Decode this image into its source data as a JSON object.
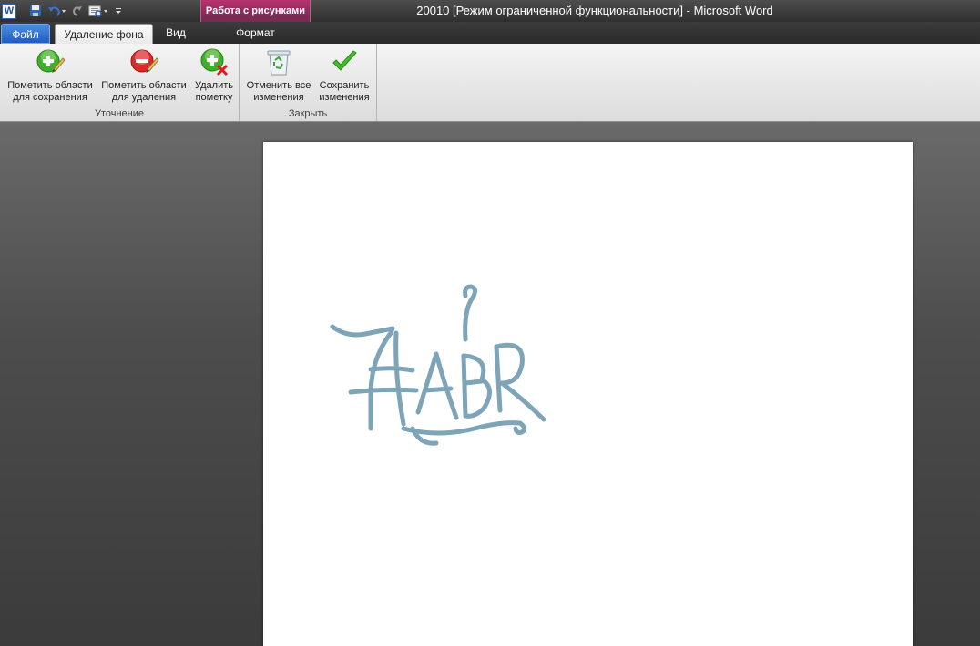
{
  "window": {
    "title": "20010 [Режим ограниченной функциональности]  -  Microsoft Word",
    "app_icon_letter": "W",
    "contextual_group": "Работа с рисунками"
  },
  "quick_access": {
    "icons": [
      "word-app-icon",
      "save-icon",
      "undo-icon",
      "redo-icon",
      "print-preview-icon",
      "customize-qat-icon"
    ]
  },
  "tabs": {
    "file": "Файл",
    "background_removal": "Удаление фона",
    "view": "Вид",
    "format": "Формат"
  },
  "ribbon": {
    "groups": {
      "refine": {
        "label": "Уточнение",
        "mark_keep": {
          "line1": "Пометить области",
          "line2": "для сохранения"
        },
        "mark_remove": {
          "line1": "Пометить области",
          "line2": "для удаления"
        },
        "delete_mark": {
          "line1": "Удалить",
          "line2": "пометку"
        }
      },
      "close": {
        "label": "Закрыть",
        "discard": {
          "line1": "Отменить все",
          "line2": "изменения"
        },
        "keep": {
          "line1": "Сохранить",
          "line2": "изменения"
        }
      }
    }
  },
  "document": {
    "picture_text": "HABR"
  },
  "colors": {
    "file_tab": "#2a6bcf",
    "contextual_tab": "#b8326f",
    "picture_stroke": "#7ea4b8"
  }
}
